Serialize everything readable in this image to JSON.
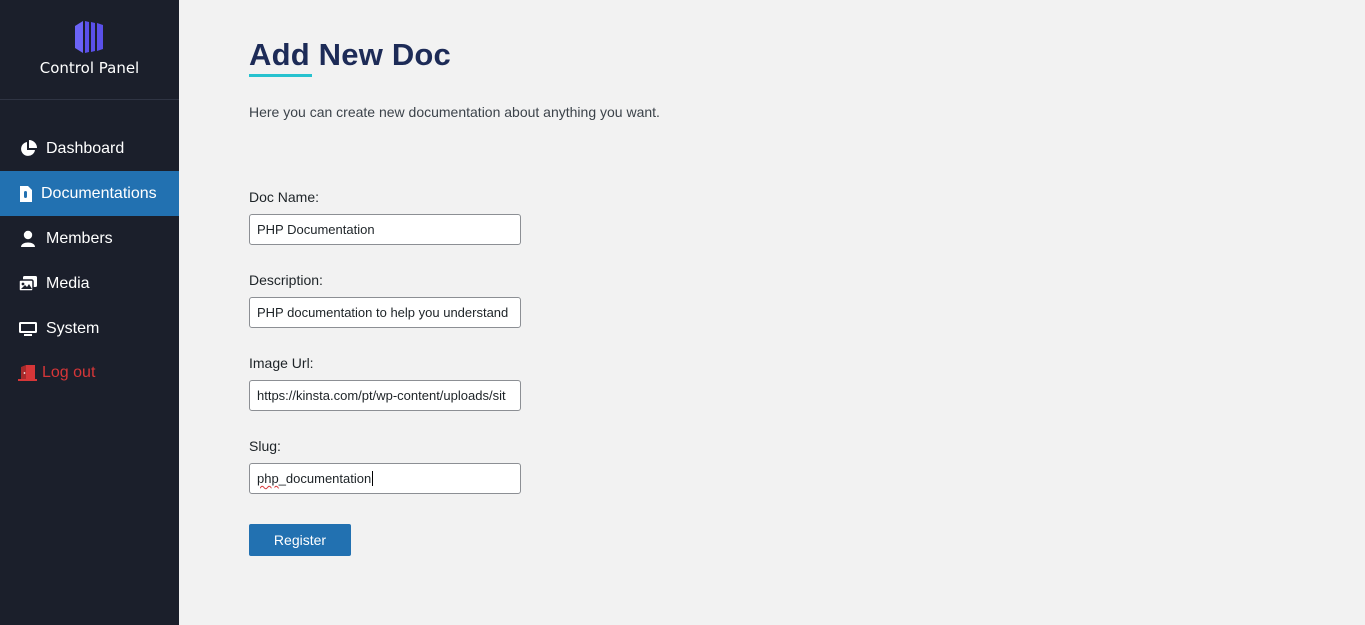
{
  "brand": {
    "title": "Control Panel",
    "logo_icon": "columns-logo-icon",
    "logo_color": "#5b5bf0"
  },
  "sidebar": {
    "items": [
      {
        "label": "Dashboard",
        "icon": "pie-chart-icon"
      },
      {
        "label": "Documentations",
        "icon": "document-icon",
        "active": true
      },
      {
        "label": "Members",
        "icon": "user-icon"
      },
      {
        "label": "Media",
        "icon": "images-icon"
      },
      {
        "label": "System",
        "icon": "monitor-icon"
      },
      {
        "label": "Log out",
        "icon": "door-exit-icon"
      }
    ]
  },
  "page": {
    "title": "Add New Doc",
    "intro": "Here you can create new documentation about anything you want."
  },
  "form": {
    "doc_name": {
      "label": "Doc Name:",
      "value": "PHP Documentation"
    },
    "description": {
      "label": "Description:",
      "value": "PHP documentation to help you understand"
    },
    "image_url": {
      "label": "Image Url:",
      "value": "https://kinsta.com/pt/wp-content/uploads/sit"
    },
    "slug": {
      "label": "Slug:",
      "value_prefix": "php",
      "value_rest": "_documentation"
    },
    "submit_label": "Register"
  },
  "colors": {
    "sidebar_bg": "#1b1f2b",
    "active_bg": "#2271b1",
    "title": "#1d2b57",
    "underline_accent": "#27c2cf",
    "logout": "#d63638"
  }
}
